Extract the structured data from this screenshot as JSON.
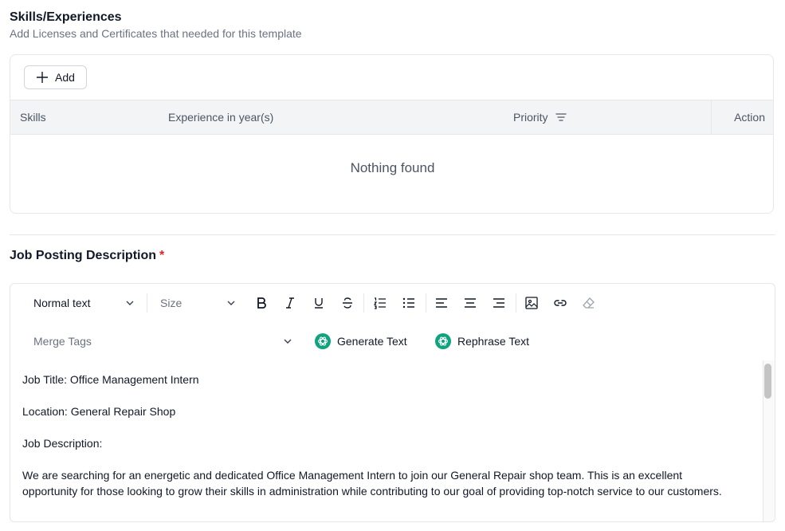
{
  "skills": {
    "title": "Skills/Experiences",
    "subtitle": "Add Licenses and Certificates that needed for this template",
    "add_label": "Add",
    "columns": {
      "skills": "Skills",
      "experience": "Experience in year(s)",
      "priority": "Priority",
      "action": "Action"
    },
    "empty_text": "Nothing found"
  },
  "job_posting": {
    "title": "Job Posting Description",
    "required_marker": "*"
  },
  "editor": {
    "text_style": "Normal text",
    "size_placeholder": "Size",
    "merge_tags_placeholder": "Merge Tags",
    "generate_label": "Generate Text",
    "rephrase_label": "Rephrase Text",
    "paragraphs": [
      "Job Title: Office Management Intern",
      "Location: General Repair Shop",
      "Job Description:",
      "We are searching for an energetic and dedicated Office Management Intern to join our General Repair shop team. This is an excellent opportunity for those looking to grow their skills in administration while contributing to our goal of providing top-notch service to our customers."
    ]
  },
  "colors": {
    "required": "#dc2626",
    "ai_icon": "#10a37f"
  },
  "icons": [
    "plus-icon",
    "filter-icon",
    "chevron-down-icon",
    "bold-icon",
    "italic-icon",
    "underline-icon",
    "strikethrough-icon",
    "ordered-list-icon",
    "bullet-list-icon",
    "align-left-icon",
    "align-center-icon",
    "align-right-icon",
    "image-icon",
    "link-icon",
    "eraser-icon",
    "openai-icon"
  ]
}
